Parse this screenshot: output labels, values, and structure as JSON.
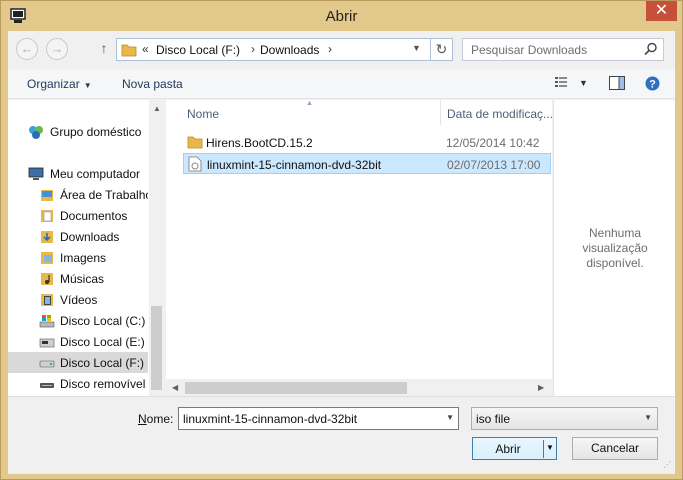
{
  "window": {
    "title": "Abrir",
    "close_glyph": "✕",
    "accent_color": "#e3c88c",
    "close_color": "#c7503b"
  },
  "address": {
    "back_glyph": "←",
    "forward_glyph": "→",
    "up_glyph": "↑",
    "overflow_glyph": "«",
    "breadcrumbs": [
      "Disco Local (F:)",
      "Downloads"
    ],
    "separator_glyph": "›",
    "refresh_glyph": "↻",
    "search_placeholder": "Pesquisar Downloads"
  },
  "toolbar": {
    "organize_label": "Organizar",
    "new_folder_label": "Nova pasta",
    "icons": [
      "view-options-icon",
      "preview-pane-icon",
      "help-icon"
    ]
  },
  "nav": {
    "items": [
      {
        "label": "Grupo doméstico",
        "icon": "homegroup-icon",
        "level": 0
      },
      {
        "label": "Meu computador",
        "icon": "computer-icon",
        "level": 0
      },
      {
        "label": "Área de Trabalho",
        "icon": "folder-icon",
        "level": 1
      },
      {
        "label": "Documentos",
        "icon": "documents-icon",
        "level": 1
      },
      {
        "label": "Downloads",
        "icon": "downloads-icon",
        "level": 1
      },
      {
        "label": "Imagens",
        "icon": "pictures-icon",
        "level": 1
      },
      {
        "label": "Músicas",
        "icon": "music-icon",
        "level": 1
      },
      {
        "label": "Vídeos",
        "icon": "videos-icon",
        "level": 1
      },
      {
        "label": "Disco Local (C:)",
        "icon": "drive-c-icon",
        "level": 1
      },
      {
        "label": "Disco Local (E:)",
        "icon": "drive-e-icon",
        "level": 1
      },
      {
        "label": "Disco Local (F:)",
        "icon": "drive-f-icon",
        "level": 1,
        "selected": true
      },
      {
        "label": "Disco removível (",
        "icon": "removable-drive-icon",
        "level": 1
      }
    ]
  },
  "files": {
    "columns": {
      "name": "Nome",
      "date": "Data de modificaç..."
    },
    "rows": [
      {
        "name": "Hirens.BootCD.15.2",
        "date": "12/05/2014 10:42",
        "icon": "folder-icon",
        "selected": false
      },
      {
        "name": "linuxmint-15-cinnamon-dvd-32bit",
        "date": "02/07/2013 17:00",
        "icon": "iso-file-icon",
        "selected": true
      }
    ]
  },
  "preview": {
    "line1": "Nenhuma",
    "line2": "visualização",
    "line3": "disponível."
  },
  "footer": {
    "name_label_accel": "N",
    "name_label_rest": "ome:",
    "filename_value": "linuxmint-15-cinnamon-dvd-32bit",
    "filter_value": "iso file",
    "open_label": "Abrir",
    "cancel_label": "Cancelar"
  }
}
